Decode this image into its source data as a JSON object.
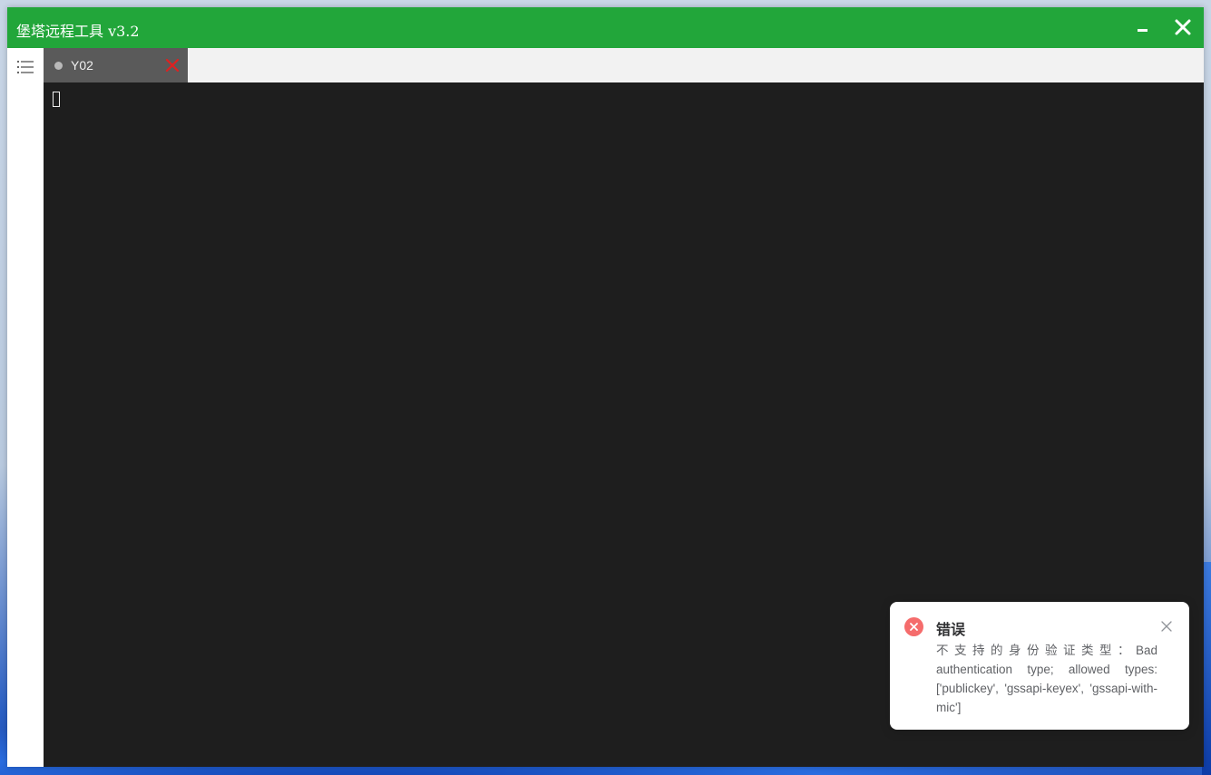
{
  "window": {
    "title": "堡塔远程工具 v3.2",
    "accent_color": "#22a63a"
  },
  "titlebar_controls": {
    "minimize_icon": "minimize-icon",
    "close_icon": "close-icon"
  },
  "sidebar": {
    "menu_icon": "menu-list-icon"
  },
  "tabs": [
    {
      "label": "Y02",
      "status_icon": "status-dot-icon",
      "close_icon": "close-icon"
    }
  ],
  "terminal": {
    "background": "#1e1e1e"
  },
  "notification": {
    "type": "error",
    "icon": "error-circle-icon",
    "title": "错误",
    "message": "不支持的身份验证类型：Bad authentication type; allowed types: ['publickey', 'gssapi-keyex', 'gssapi-with-mic']",
    "status_color": "#f56c6c"
  }
}
